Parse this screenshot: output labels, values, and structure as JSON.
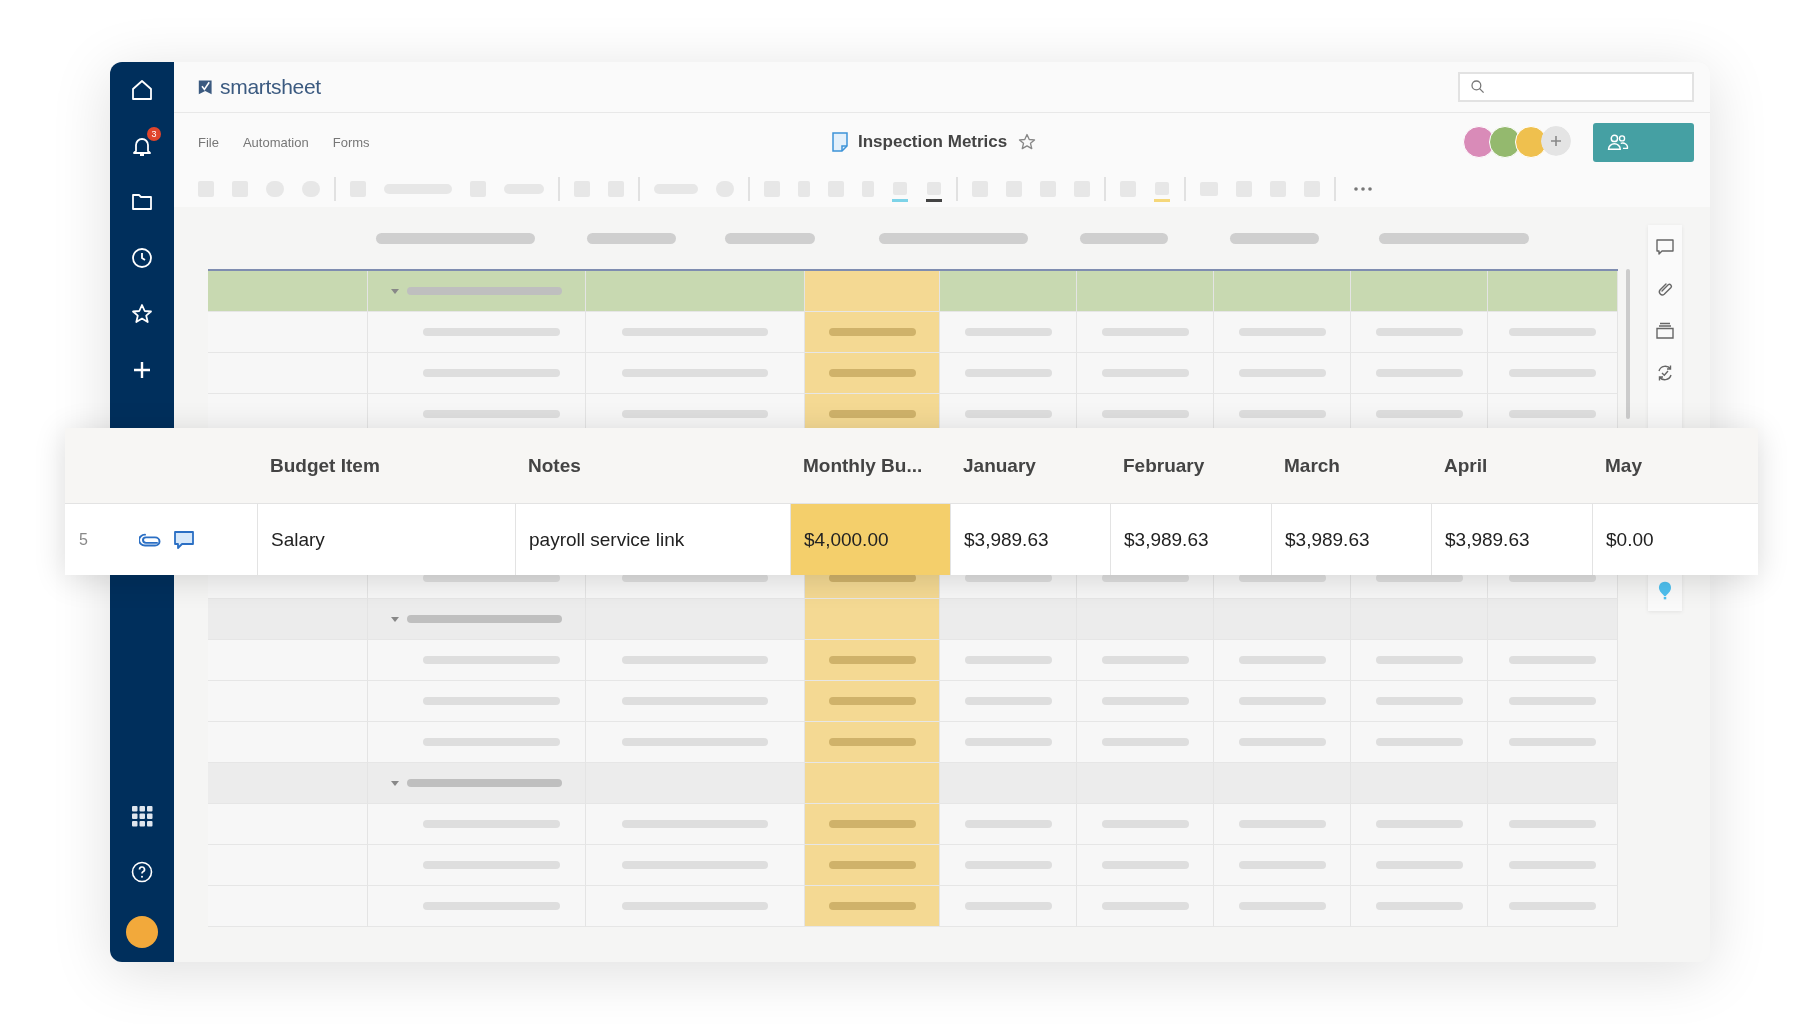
{
  "nav": {
    "notification_count": "3"
  },
  "app": {
    "logo": "smartsheet"
  },
  "menu": [
    "File",
    "Automation",
    "Forms"
  ],
  "sheet": {
    "title": "Inspection Metrics",
    "favorited": false
  },
  "collaborators": [
    {
      "color": "#d98bb8"
    },
    {
      "color": "#94b96e"
    },
    {
      "color": "#efc04e"
    }
  ],
  "sheet_groups": [
    {
      "selected": true
    },
    {
      "selected": false
    },
    {
      "selected": false
    }
  ],
  "popout": {
    "row_number": "5",
    "columns": [
      {
        "title": "Budget Item",
        "highlighted": false
      },
      {
        "title": "Notes",
        "highlighted": false
      },
      {
        "title": "Monthly Bu...",
        "highlighted": true
      },
      {
        "title": "January",
        "highlighted": false
      },
      {
        "title": "February",
        "highlighted": false
      },
      {
        "title": "March",
        "highlighted": false
      },
      {
        "title": "April",
        "highlighted": false
      },
      {
        "title": "May",
        "highlighted": false
      }
    ],
    "cells": [
      "Salary",
      "payroll service link",
      "$4,000.00",
      "$3,989.63",
      "$3,989.63",
      "$3,989.63",
      "$3,989.63",
      "$0.00"
    ]
  }
}
